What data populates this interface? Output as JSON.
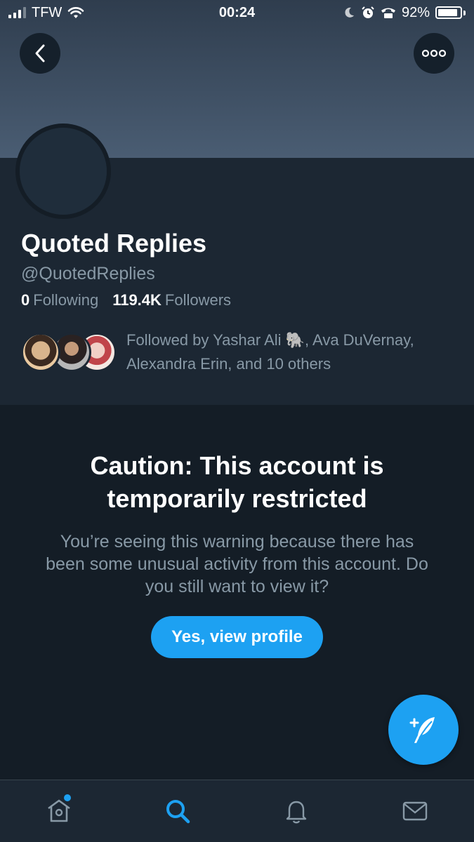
{
  "status_bar": {
    "carrier": "TFW",
    "time": "00:24",
    "battery": "92%"
  },
  "profile": {
    "display_name": "Quoted Replies",
    "handle": "@QuotedReplies",
    "following_count": "0",
    "following_label": "Following",
    "followers_count": "119.4K",
    "followers_label": "Followers",
    "followed_by_text": "Followed by Yashar Ali 🐘, Ava DuVernay, Alexandra Erin, and 10 others"
  },
  "warning": {
    "title": "Caution: This account is temporarily restricted",
    "body": "You’re seeing this warning because there has been some unusual activity from this account. Do you still want to view it?",
    "button_label": "Yes, view profile"
  },
  "tabs": [
    {
      "icon": "home-icon"
    },
    {
      "icon": "search-icon",
      "active": true
    },
    {
      "icon": "bell-icon"
    },
    {
      "icon": "mail-icon"
    }
  ],
  "colors": {
    "accent": "#1da1f2",
    "background": "#141d26",
    "secondary_text": "#8899a6"
  }
}
